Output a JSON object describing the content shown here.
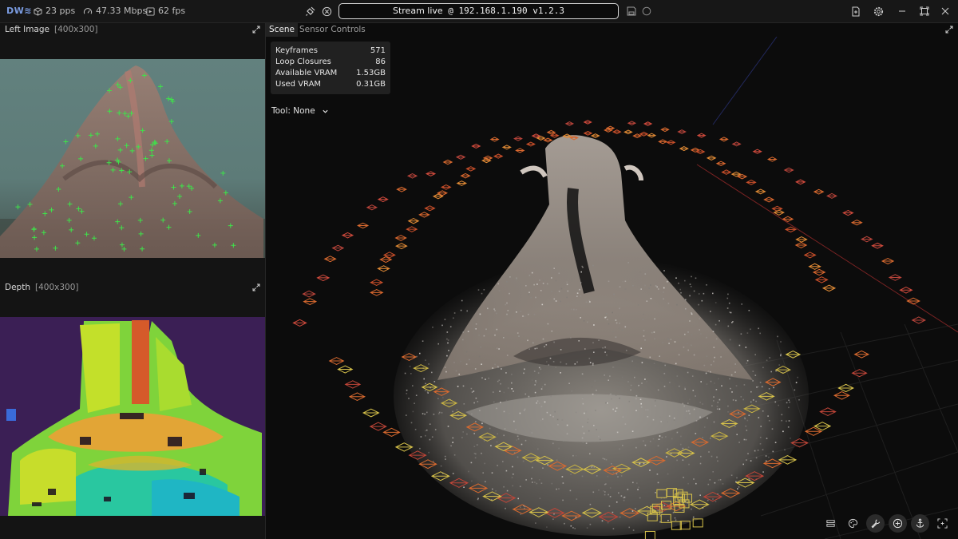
{
  "topbar": {
    "logo_main": "DW",
    "logo_accent": "≋",
    "pps": "23 pps",
    "bandwidth": "47.33 Mbps",
    "fps": "62 fps",
    "stream_label": "Stream live",
    "stream_address": "@ 192.168.1.190 v1.2.3",
    "icons": [
      "plug-icon",
      "stop-icon",
      "save-icon",
      "record-icon",
      "add-file-icon",
      "gear-icon",
      "minimize-icon",
      "maximize-icon",
      "close-icon"
    ]
  },
  "left_panel": {
    "image_title": "Left Image",
    "image_size": "[400x300]",
    "depth_title": "Depth",
    "depth_size": "[400x300]"
  },
  "main": {
    "tabs": [
      "Scene",
      "Sensor Controls"
    ],
    "active_tab": "Scene",
    "stats": [
      {
        "label": "Keyframes",
        "value": "571"
      },
      {
        "label": "Loop Closures",
        "value": "86"
      },
      {
        "label": "Available VRAM",
        "value": "1.53GB"
      },
      {
        "label": "Used VRAM",
        "value": "0.31GB"
      }
    ],
    "tool_label": "Tool: None"
  },
  "colors": {
    "background": "#0c0c0c",
    "panel": "#141414",
    "accent": "#7a9be0",
    "feature_points": "#3ee34a",
    "trajectory_warm": "#d96a2f",
    "trajectory_yellow": "#d7c24a"
  }
}
